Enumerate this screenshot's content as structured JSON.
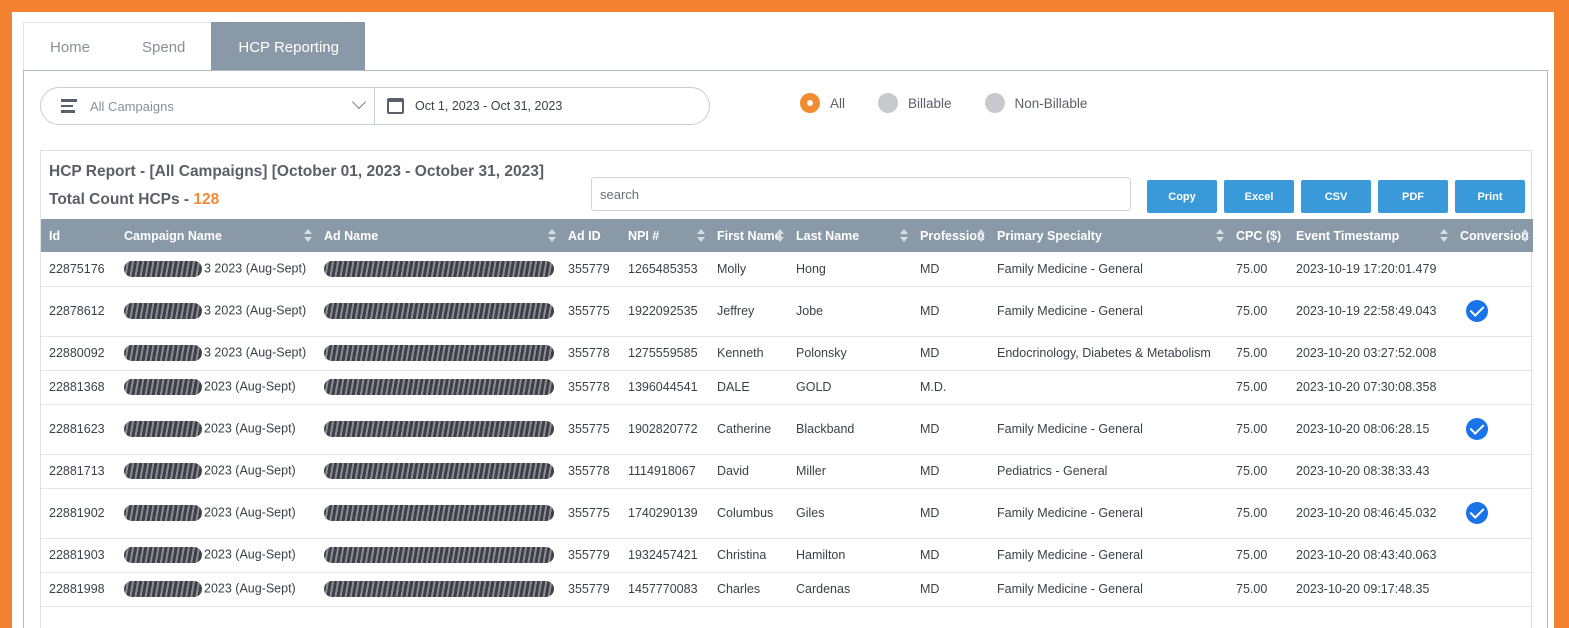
{
  "tabs": [
    {
      "label": "Home"
    },
    {
      "label": "Spend"
    },
    {
      "label": "HCP Reporting"
    }
  ],
  "filters": {
    "campaign": "All Campaigns",
    "date_range": "Oct 1, 2023 - Oct 31, 2023",
    "radios": [
      {
        "label": "All",
        "selected": true
      },
      {
        "label": "Billable",
        "selected": false
      },
      {
        "label": "Non-Billable",
        "selected": false
      }
    ]
  },
  "report": {
    "title": "HCP Report - [All Campaigns] [October 01, 2023 - October 31, 2023]",
    "count_label": "Total Count HCPs - ",
    "count": "128",
    "search_placeholder": "search",
    "buttons": {
      "copy": "Copy",
      "excel": "Excel",
      "csv": "CSV",
      "pdf": "PDF",
      "print": "Print"
    }
  },
  "table": {
    "headers": [
      "Id",
      "Campaign Name",
      "Ad Name",
      "Ad ID",
      "NPI #",
      "First Name",
      "Last Name",
      "Profession",
      "Primary Specialty",
      "CPC ($)",
      "Event Timestamp",
      "Conversion"
    ],
    "rows": [
      {
        "id": "22875176",
        "campaign": "3 2023 (Aug-Sept)",
        "ad_id": "355779",
        "npi": "1265485353",
        "first": "Molly",
        "last": "Hong",
        "profession": "MD",
        "specialty": "Family Medicine - General",
        "cpc": "75.00",
        "timestamp": "2023-10-19 17:20:01.479",
        "conversion": false
      },
      {
        "id": "22878612",
        "campaign": "3 2023 (Aug-Sept)",
        "ad_id": "355775",
        "npi": "1922092535",
        "first": "Jeffrey",
        "last": "Jobe",
        "profession": "MD",
        "specialty": "Family Medicine - General",
        "cpc": "75.00",
        "timestamp": "2023-10-19 22:58:49.043",
        "conversion": true
      },
      {
        "id": "22880092",
        "campaign": "3 2023 (Aug-Sept)",
        "ad_id": "355778",
        "npi": "1275559585",
        "first": "Kenneth",
        "last": "Polonsky",
        "profession": "MD",
        "specialty": "Endocrinology, Diabetes & Metabolism",
        "cpc": "75.00",
        "timestamp": "2023-10-20 03:27:52.008",
        "conversion": false
      },
      {
        "id": "22881368",
        "campaign": "2023 (Aug-Sept)",
        "ad_id": "355778",
        "npi": "1396044541",
        "first": "DALE",
        "last": "GOLD",
        "profession": "M.D.",
        "specialty": "",
        "cpc": "75.00",
        "timestamp": "2023-10-20 07:30:08.358",
        "conversion": false
      },
      {
        "id": "22881623",
        "campaign": "2023 (Aug-Sept)",
        "ad_id": "355775",
        "npi": "1902820772",
        "first": "Catherine",
        "last": "Blackband",
        "profession": "MD",
        "specialty": "Family Medicine - General",
        "cpc": "75.00",
        "timestamp": "2023-10-20 08:06:28.15",
        "conversion": true
      },
      {
        "id": "22881713",
        "campaign": "2023 (Aug-Sept)",
        "ad_id": "355778",
        "npi": "1114918067",
        "first": "David",
        "last": "Miller",
        "profession": "MD",
        "specialty": "Pediatrics - General",
        "cpc": "75.00",
        "timestamp": "2023-10-20 08:38:33.43",
        "conversion": false
      },
      {
        "id": "22881902",
        "campaign": "2023 (Aug-Sept)",
        "ad_id": "355775",
        "npi": "1740290139",
        "first": "Columbus",
        "last": "Giles",
        "profession": "MD",
        "specialty": "Family Medicine - General",
        "cpc": "75.00",
        "timestamp": "2023-10-20 08:46:45.032",
        "conversion": true
      },
      {
        "id": "22881903",
        "campaign": "2023 (Aug-Sept)",
        "ad_id": "355779",
        "npi": "1932457421",
        "first": "Christina",
        "last": "Hamilton",
        "profession": "MD",
        "specialty": "Family Medicine - General",
        "cpc": "75.00",
        "timestamp": "2023-10-20 08:43:40.063",
        "conversion": false
      },
      {
        "id": "22881998",
        "campaign": "2023 (Aug-Sept)",
        "ad_id": "355779",
        "npi": "1457770083",
        "first": "Charles",
        "last": "Cardenas",
        "profession": "MD",
        "specialty": "Family Medicine - General",
        "cpc": "75.00",
        "timestamp": "2023-10-20 09:17:48.35",
        "conversion": false
      }
    ]
  },
  "colors": {
    "accent": "#f28b30",
    "header_bg": "#8a99a8",
    "button_bg": "#3a9ad9",
    "check": "#1a73e8"
  }
}
